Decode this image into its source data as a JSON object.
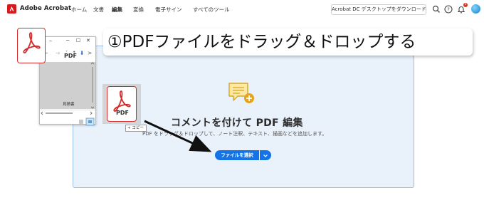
{
  "app": {
    "name": "Adobe Acrobat"
  },
  "nav": {
    "items": [
      {
        "label": "ホーム",
        "dropdown": false
      },
      {
        "label": "文書",
        "dropdown": false
      },
      {
        "label": "編集",
        "dropdown": true,
        "active": true
      },
      {
        "label": "変換",
        "dropdown": true
      },
      {
        "label": "電子サイン",
        "dropdown": true
      },
      {
        "label": "すべてのツール",
        "dropdown": false
      }
    ],
    "chevron": "⌄"
  },
  "header": {
    "download_label": "Acrobat DC デスクトップをダウンロード",
    "icons": [
      "search-icon",
      "help-icon",
      "bell-icon",
      "avatar"
    ],
    "notification_count": "5"
  },
  "panel": {
    "title": "コメントを付けて PDF 編集",
    "description": "PDF をドラッグ＆ドロップして、ノート注釈、テキスト、描画などを追加します。",
    "select_button_label": "ファイルを選択",
    "icon": "comment-add-icon"
  },
  "explorer": {
    "title_arrow": "⬇",
    "title_dash": "–",
    "minimize": "─",
    "maximize": "☐",
    "close": "✕",
    "nav_back": "←",
    "nav_forward": "→",
    "nav_dropdown": "˅",
    "nav_up": "↑",
    "nav_down": "⬇",
    "nav_sep": ">",
    "file_type_label": "PDF",
    "file_name": "見積書"
  },
  "dragged_file": {
    "file_type_label": "PDF",
    "copy_label": "+ コピー"
  },
  "annotation": {
    "instruction": "①PDFファイルをドラッグ＆ドロップする"
  },
  "colors": {
    "accent": "#1473e6",
    "acrobat_red": "#d7191c",
    "panel_bg": "#e9f1fb",
    "panel_border": "#9bbfe6"
  }
}
